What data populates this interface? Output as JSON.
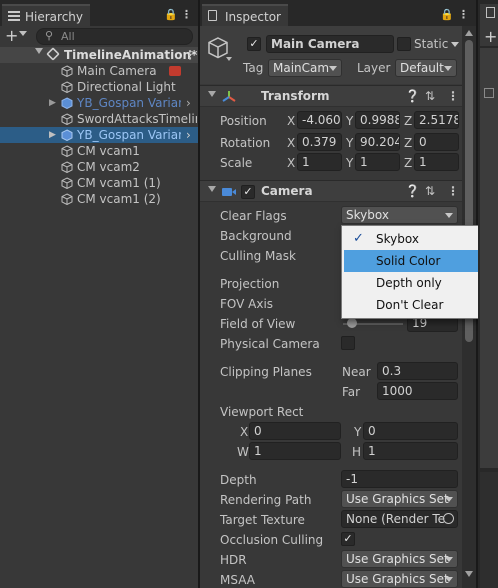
{
  "hierarchy": {
    "tab_label": "Hierarchy",
    "search_placeholder": "All",
    "items": [
      {
        "label": "TimelineAnimation*",
        "kind": "scene"
      },
      {
        "label": "Main Camera",
        "kind": "object"
      },
      {
        "label": "Directional Light",
        "kind": "object"
      },
      {
        "label": "YB_Gospan Variant",
        "kind": "prefab"
      },
      {
        "label": "SwordAttacksTimeline",
        "kind": "object"
      },
      {
        "label": "YB_Gospan Variant",
        "kind": "prefab-selected"
      },
      {
        "label": "CM vcam1",
        "kind": "object"
      },
      {
        "label": "CM vcam2",
        "kind": "object"
      },
      {
        "label": "CM vcam1 (1)",
        "kind": "object"
      },
      {
        "label": "CM vcam1 (2)",
        "kind": "object"
      }
    ]
  },
  "inspector": {
    "tab_label": "Inspector",
    "object_name": "Main Camera",
    "static_label": "Static",
    "tag_label": "Tag",
    "tag_value": "MainCam",
    "layer_label": "Layer",
    "layer_value": "Default",
    "transform": {
      "title": "Transform",
      "position_label": "Position",
      "rotation_label": "Rotation",
      "scale_label": "Scale",
      "axes": [
        "X",
        "Y",
        "Z"
      ],
      "position": [
        "-4.060",
        "0.9988",
        "2.5178"
      ],
      "rotation": [
        "0.379",
        "90.204",
        "0"
      ],
      "scale": [
        "1",
        "1",
        "1"
      ]
    },
    "camera": {
      "title": "Camera",
      "clear_flags_label": "Clear Flags",
      "clear_flags_value": "Skybox",
      "background_label": "Background",
      "culling_mask_label": "Culling Mask",
      "projection_label": "Projection",
      "fov_axis_label": "FOV Axis",
      "field_of_view_label": "Field of View",
      "field_of_view_value": "19",
      "physical_camera_label": "Physical Camera",
      "clipping_planes_label": "Clipping Planes",
      "near_label": "Near",
      "near_value": "0.3",
      "far_label": "Far",
      "far_value": "1000",
      "viewport_rect_label": "Viewport Rect",
      "vx_label": "X",
      "vx_value": "0",
      "vy_label": "Y",
      "vy_value": "0",
      "vw_label": "W",
      "vw_value": "1",
      "vh_label": "H",
      "vh_value": "1",
      "depth_label": "Depth",
      "depth_value": "-1",
      "rendering_path_label": "Rendering Path",
      "rendering_path_value": "Use Graphics Set",
      "target_texture_label": "Target Texture",
      "target_texture_value": "None (Render Te",
      "occlusion_label": "Occlusion Culling",
      "hdr_label": "HDR",
      "hdr_value": "Use Graphics Set",
      "msaa_label": "MSAA",
      "msaa_value": "Use Graphics Set"
    },
    "clear_flags_menu": {
      "options": [
        "Skybox",
        "Solid Color",
        "Depth only",
        "Don't Clear"
      ],
      "checked": "Skybox",
      "highlighted": "Solid Color"
    }
  },
  "colors": {
    "highlight": "#4f9fdf",
    "prefab_text": "#7ca8e8",
    "selected_row": "#2c5d87"
  }
}
